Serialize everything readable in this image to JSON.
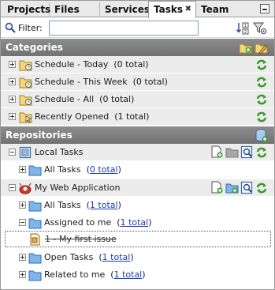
{
  "tabs": [
    {
      "label": "Projects",
      "active": false
    },
    {
      "label": "Files",
      "active": false
    },
    {
      "label": "Services",
      "active": false
    },
    {
      "label": "Tasks",
      "active": true
    },
    {
      "label": "Team",
      "active": false
    }
  ],
  "tab_close_glyph": "✖",
  "filter": {
    "label": "Filter:",
    "value": "",
    "placeholder": ""
  },
  "categories": {
    "title": "Categories",
    "items": [
      {
        "label": "Schedule - Today",
        "count": "(0 total)"
      },
      {
        "label": "Schedule - This Week",
        "count": "(0 total)"
      },
      {
        "label": "Schedule - All",
        "count": "(0 total)"
      },
      {
        "label": "Recently Opened",
        "count": "(1 total)"
      }
    ]
  },
  "repositories": {
    "title": "Repositories",
    "local": {
      "label": "Local Tasks",
      "children": [
        {
          "label": "All Tasks",
          "count": "0 total"
        }
      ]
    },
    "web": {
      "label": "My Web Application",
      "children": [
        {
          "label": "All Tasks",
          "count": "1 total"
        },
        {
          "label": "Assigned to me",
          "count": "1 total"
        },
        {
          "label": "1 - My first issue",
          "count": ""
        },
        {
          "label": "Open Tasks",
          "count": "1 total"
        },
        {
          "label": "Related to me",
          "count": "1 total"
        }
      ]
    }
  },
  "colors": {
    "section_bg": "#7f7f7f",
    "link": "#1a3db6",
    "folder": "#5aa0e0",
    "refresh": "#3a9a2a"
  }
}
